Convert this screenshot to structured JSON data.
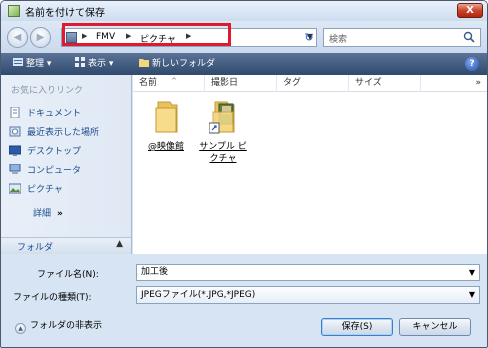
{
  "window": {
    "title": "名前を付けて保存",
    "close_label": "X"
  },
  "address": {
    "crumbs": [
      "FMV",
      "ピクチャ"
    ],
    "search_placeholder": "検索"
  },
  "toolbar": {
    "organize": "整理",
    "views": "表示",
    "new_folder": "新しいフォルダ"
  },
  "sidebar": {
    "header": "お気に入りリンク",
    "items": [
      {
        "label": "ドキュメント",
        "icon": "documents-icon"
      },
      {
        "label": "最近表示した場所",
        "icon": "recent-places-icon"
      },
      {
        "label": "デスクトップ",
        "icon": "desktop-icon"
      },
      {
        "label": "コンピュータ",
        "icon": "computer-icon"
      },
      {
        "label": "ピクチャ",
        "icon": "pictures-icon"
      }
    ],
    "more": "詳細",
    "more_glyph": "»",
    "folders_label": "フォルダ"
  },
  "columns": [
    "名前",
    "撮影日",
    "タグ",
    "サイズ"
  ],
  "columns_more": "»",
  "files": [
    {
      "name": "@映像館",
      "type": "folder"
    },
    {
      "name_line1": "サンプル ピ",
      "name_line2": "クチャ",
      "type": "shortcut-folder"
    }
  ],
  "form": {
    "filename_label": "ファイル名(N):",
    "filename_value": "加工後",
    "filetype_label": "ファイルの種類(T):",
    "filetype_value": "JPEGファイル(*.JPG,*JPEG)"
  },
  "footer": {
    "hide_folders": "フォルダの非表示",
    "save": "保存(S)",
    "cancel": "キャンセル"
  },
  "colors": {
    "highlight": "#e0192e",
    "toolbar": "#3a5578",
    "link": "#1d4c8e"
  }
}
